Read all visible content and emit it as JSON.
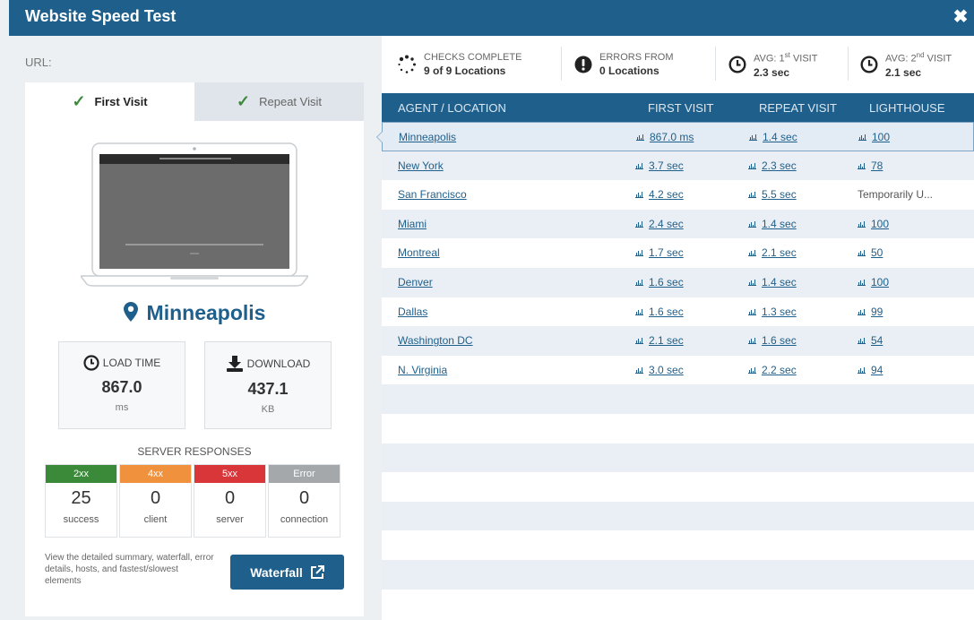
{
  "titlebar": {
    "title": "Website Speed Test",
    "close_glyph": "✖"
  },
  "left": {
    "url_label": "URL:",
    "tabs": [
      {
        "label": "First Visit",
        "active": true
      },
      {
        "label": "Repeat Visit",
        "active": false
      }
    ],
    "location": "Minneapolis",
    "load_time": {
      "label": "LOAD TIME",
      "value": "867.0",
      "unit": "ms"
    },
    "download": {
      "label": "DOWNLOAD",
      "value": "437.1",
      "unit": "KB"
    },
    "server_responses": {
      "title": "SERVER RESPONSES",
      "items": [
        {
          "code": "2xx",
          "count": "25",
          "label": "success",
          "color": "#3a8a3a"
        },
        {
          "code": "4xx",
          "count": "0",
          "label": "client",
          "color": "#f0913e"
        },
        {
          "code": "5xx",
          "count": "0",
          "label": "server",
          "color": "#d9363a"
        },
        {
          "code": "Error",
          "count": "0",
          "label": "connection",
          "color": "#a5a8ab"
        }
      ]
    },
    "footnote": "View the detailed summary, waterfall, error details, hosts, and fastest/slowest elements",
    "waterfall_label": "Waterfall"
  },
  "summary": {
    "checks": {
      "line1": "CHECKS COMPLETE",
      "line2": "9 of 9 Locations"
    },
    "errors": {
      "line1": "ERRORS FROM",
      "line2": "0 Locations"
    },
    "avg_first": {
      "line1_pre": "AVG: 1",
      "line1_sup": "st",
      "line1_post": " VISIT",
      "line2": "2.3 sec"
    },
    "avg_second": {
      "line1_pre": "AVG: 2",
      "line1_sup": "nd",
      "line1_post": " VISIT",
      "line2": "2.1 sec"
    }
  },
  "table": {
    "headers": [
      "AGENT / LOCATION",
      "FIRST VISIT",
      "REPEAT VISIT",
      "LIGHTHOUSE"
    ],
    "rows": [
      {
        "location": "Minneapolis",
        "first": "867.0 ms",
        "repeat": "1.4 sec",
        "lighthouse": "100"
      },
      {
        "location": "New York",
        "first": "3.7 sec",
        "repeat": "2.3 sec",
        "lighthouse": "78"
      },
      {
        "location": "San Francisco",
        "first": "4.2 sec",
        "repeat": "5.5 sec",
        "lighthouse": "Temporarily U..."
      },
      {
        "location": "Miami",
        "first": "2.4 sec",
        "repeat": "1.4 sec",
        "lighthouse": "100"
      },
      {
        "location": "Montreal",
        "first": "1.7 sec",
        "repeat": "2.1 sec",
        "lighthouse": "50"
      },
      {
        "location": "Denver",
        "first": "1.6 sec",
        "repeat": "1.4 sec",
        "lighthouse": "100"
      },
      {
        "location": "Dallas",
        "first": "1.6 sec",
        "repeat": "1.3 sec",
        "lighthouse": "99"
      },
      {
        "location": "Washington DC",
        "first": "2.1 sec",
        "repeat": "1.6 sec",
        "lighthouse": "54"
      },
      {
        "location": "N. Virginia",
        "first": "3.0 sec",
        "repeat": "2.2 sec",
        "lighthouse": "94"
      }
    ],
    "selected_index": 0
  },
  "colors": {
    "brand": "#1f5f8b",
    "success": "#3a8a3a"
  }
}
